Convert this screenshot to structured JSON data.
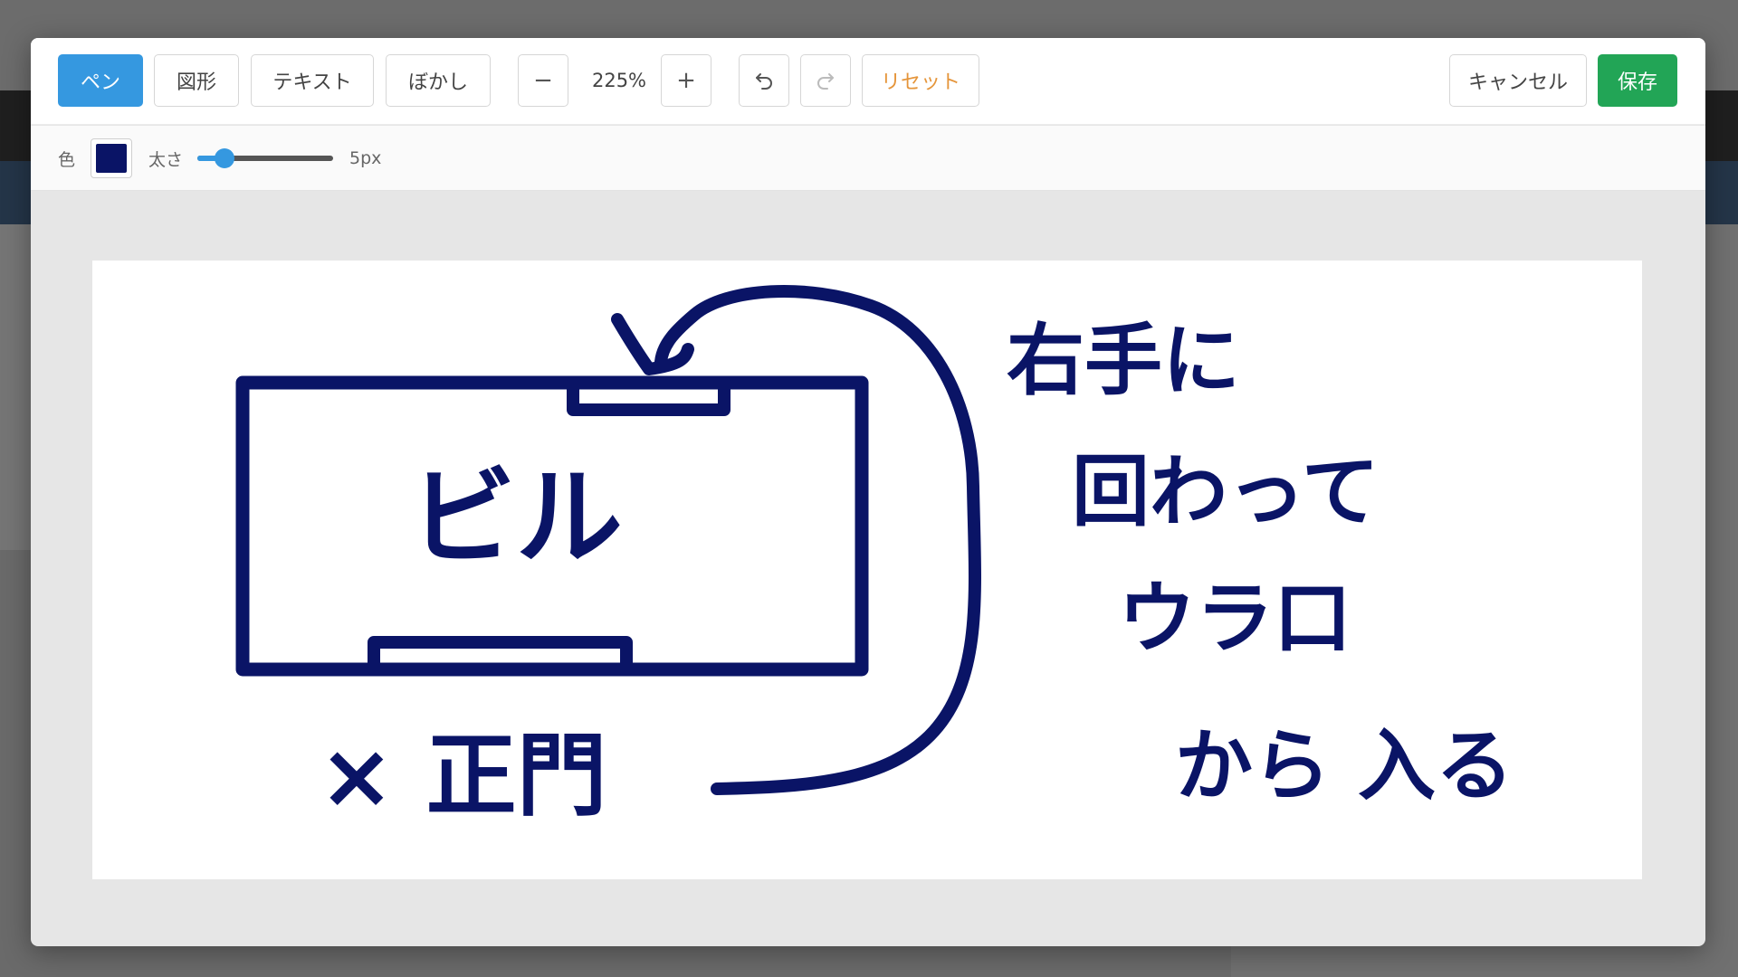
{
  "toolbar": {
    "tools": {
      "pen": "ペン",
      "shape": "図形",
      "text": "テキスト",
      "blur": "ぼかし"
    },
    "zoom": {
      "value": "225%",
      "out_symbol": "−",
      "in_symbol": "+"
    },
    "undo_icon": "undo-icon",
    "redo_icon": "redo-icon",
    "reset": "リセット",
    "cancel": "キャンセル",
    "save": "保存"
  },
  "properties": {
    "color_label": "色",
    "color_value": "#0a1466",
    "width_label": "太さ",
    "width_value": "5px",
    "width_level": 0.2
  },
  "colors": {
    "active_tool": "#3598e0",
    "save_button": "#22a556",
    "reset_text": "#e5953a",
    "ink": "#0a1466"
  },
  "drawing": {
    "building_label": "ビル",
    "main_gate_label": "× 正門",
    "note_lines": [
      "右手に",
      "回わって",
      "ウラ口",
      "から 入る"
    ]
  }
}
